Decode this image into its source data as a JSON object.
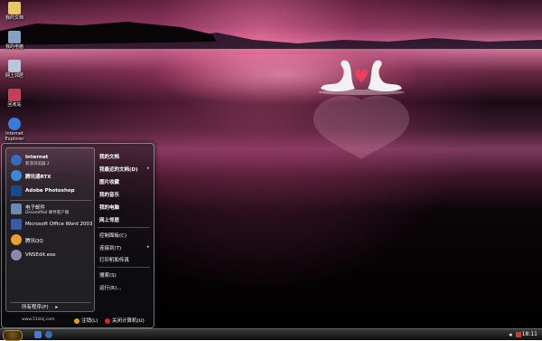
{
  "desktop_icons": [
    {
      "label": "我的文档",
      "icon": "my-documents-icon",
      "color": "#e8c860"
    },
    {
      "label": "我的电脑",
      "icon": "my-computer-icon",
      "color": "#8aa0c0"
    },
    {
      "label": "网上邻居",
      "icon": "network-places-icon",
      "color": "#b8c8d8"
    },
    {
      "label": "回收站",
      "icon": "recycle-bin-icon",
      "color": "#c04060"
    },
    {
      "label": "Internet Explorer",
      "icon": "internet-explorer-icon",
      "color": "#3a7ad8"
    }
  ],
  "start_menu": {
    "programs": [
      {
        "title": "Internet",
        "subtitle": "新浪浏览器 2",
        "icon": "browser-icon",
        "color": "#3a6ac0"
      },
      {
        "title": "腾讯通RTX",
        "subtitle": "",
        "icon": "rtx-icon",
        "color": "#3a8ad8"
      },
      {
        "title": "Adobe Photoshop",
        "subtitle": "",
        "icon": "photoshop-icon",
        "color": "#1a4a8a"
      },
      {
        "title": "电子邮件",
        "subtitle": "DreamMail 邮件客户端",
        "icon": "email-icon",
        "color": "#6a8ab0"
      },
      {
        "title": "Microsoft Office Word 2003",
        "subtitle": "",
        "icon": "word-icon",
        "color": "#3a5aa8"
      },
      {
        "title": "腾讯QQ",
        "subtitle": "",
        "icon": "qq-icon",
        "color": "#e8a030"
      },
      {
        "title": "VNSEdit.exe",
        "subtitle": "",
        "icon": "vnsedit-icon",
        "color": "#8a8ab0"
      }
    ],
    "all_programs": "所有程序(P)",
    "right_items": [
      {
        "label": "我的文档",
        "bold": true,
        "arrow": false
      },
      {
        "label": "我最近的文档(D)",
        "bold": true,
        "arrow": true
      },
      {
        "label": "图片收藏",
        "bold": true,
        "arrow": false
      },
      {
        "label": "我的音乐",
        "bold": true,
        "arrow": false
      },
      {
        "label": "我的电脑",
        "bold": true,
        "arrow": false
      },
      {
        "label": "网上邻居",
        "bold": true,
        "arrow": false
      },
      {
        "label": "控制面板(C)",
        "bold": false,
        "arrow": false
      },
      {
        "label": "连接到(T)",
        "bold": false,
        "arrow": true
      },
      {
        "label": "打印机和传真",
        "bold": false,
        "arrow": false
      },
      {
        "label": "搜索(S)",
        "bold": false,
        "arrow": false
      },
      {
        "label": "运行(R)...",
        "bold": false,
        "arrow": false
      }
    ],
    "url": "www.51ztzj.com",
    "logoff": "注销(L)",
    "shutdown": "关闭计算机(U)"
  },
  "taskbar": {
    "clock": "18:11"
  },
  "colors": {
    "accent": "#d97a9f"
  }
}
